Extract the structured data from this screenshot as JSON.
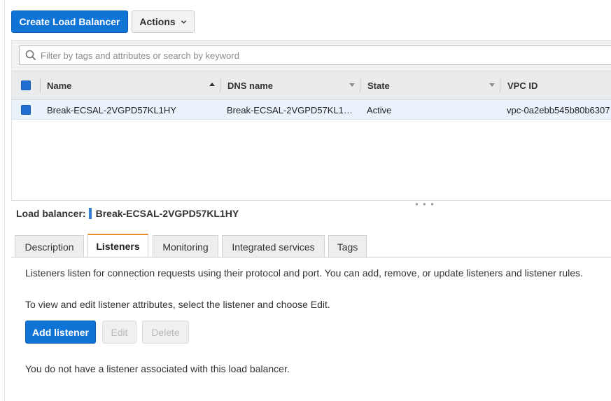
{
  "toolbar": {
    "create_label": "Create Load Balancer",
    "actions_label": "Actions"
  },
  "search": {
    "placeholder": "Filter by tags and attributes or search by keyword"
  },
  "table": {
    "columns": [
      "Name",
      "DNS name",
      "State",
      "VPC ID"
    ],
    "rows": [
      {
        "name": "Break-ECSAL-2VGPD57KL1HY",
        "dns_name": "Break-ECSAL-2VGPD57KL1…",
        "state": "Active",
        "vpc_id": "vpc-0a2ebb545b80b6307"
      }
    ]
  },
  "detail": {
    "label": "Load balancer:",
    "lb_name": "Break-ECSAL-2VGPD57KL1HY",
    "tabs": [
      "Description",
      "Listeners",
      "Monitoring",
      "Integrated services",
      "Tags"
    ],
    "active_tab": "Listeners",
    "intro": "Listeners listen for connection requests using their protocol and port. You can add, remove, or update listeners and listener rules.",
    "edit_hint": "To view and edit listener attributes, select the listener and choose Edit.",
    "buttons": {
      "add": "Add listener",
      "edit": "Edit",
      "delete": "Delete"
    },
    "empty_message": "You do not have a listener associated with this load balancer."
  },
  "colors": {
    "primary": "#0f74d6",
    "active_tab_accent": "#ec8b24",
    "selected_row": "#eaf2fc"
  }
}
